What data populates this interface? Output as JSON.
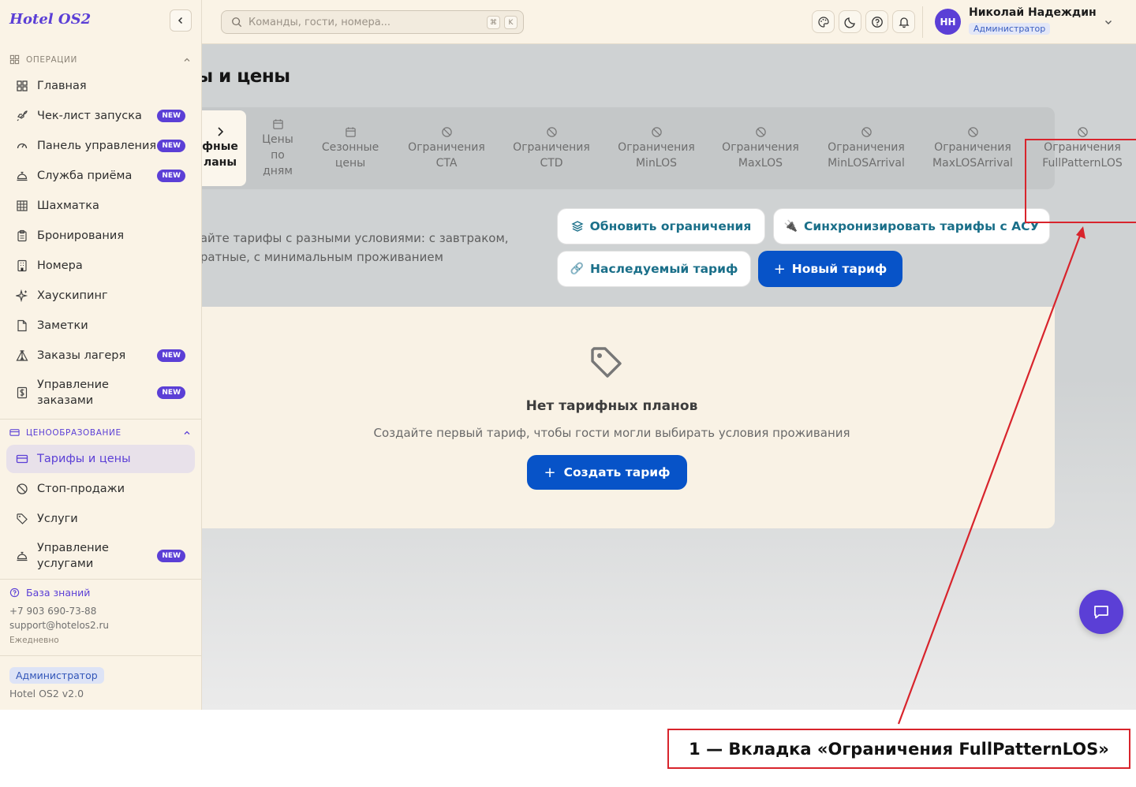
{
  "app": {
    "logo": "Hotel OS2"
  },
  "search": {
    "placeholder": "Команды, гости, номера...",
    "key1": "⌘",
    "key2": "K"
  },
  "user": {
    "initials": "НН",
    "name": "Николай Надеждин",
    "role": "Администратор"
  },
  "sidebar": {
    "section_ops": "ОПЕРАЦИИ",
    "ops_items": [
      {
        "label": "Главная",
        "icon": "dashboard-icon"
      },
      {
        "label": "Чек-лист запуска",
        "icon": "rocket-icon",
        "badge": "NEW"
      },
      {
        "label": "Панель управления",
        "icon": "gauge-icon",
        "badge": "NEW"
      },
      {
        "label": "Служба приёма",
        "icon": "bell-service-icon",
        "badge": "NEW"
      },
      {
        "label": "Шахматка",
        "icon": "grid-icon"
      },
      {
        "label": "Бронирования",
        "icon": "clipboard-icon"
      },
      {
        "label": "Номера",
        "icon": "building-icon"
      },
      {
        "label": "Хаускипинг",
        "icon": "sparkles-icon"
      },
      {
        "label": "Заметки",
        "icon": "note-icon"
      },
      {
        "label": "Заказы лагеря",
        "icon": "tent-icon",
        "badge": "NEW"
      },
      {
        "label": "Управление заказами",
        "icon": "dollar-doc-icon",
        "badge": "NEW"
      }
    ],
    "section_pricing": "ЦЕНООБРАЗОВАНИЕ",
    "pricing_items": [
      {
        "label": "Тарифы и цены",
        "icon": "card-icon"
      },
      {
        "label": "Стоп-продажи",
        "icon": "ban-icon"
      },
      {
        "label": "Услуги",
        "icon": "tag-icon"
      },
      {
        "label": "Управление услугами",
        "icon": "bell-service-icon",
        "badge": "NEW"
      }
    ],
    "knowledge_base": "База знаний",
    "phone": "+7 903 690-73-88",
    "email": "support@hotelos2.ru",
    "schedule": "Ежедневно",
    "role": "Администратор",
    "version": "Hotel OS2 v2.0"
  },
  "page": {
    "title": "фы и цены",
    "tabs": [
      {
        "label": "фные ланы",
        "active": true
      },
      {
        "label": "Цены по дням"
      },
      {
        "label": "Сезонные цены"
      },
      {
        "label": "Ограничения CTA"
      },
      {
        "label": "Ограничения CTD"
      },
      {
        "label": "Ограничения MinLOS"
      },
      {
        "label": "Ограничения MaxLOS"
      },
      {
        "label": "Ограничения MinLOSArrival"
      },
      {
        "label": "Ограничения MaxLOSArrival"
      },
      {
        "label": "Ограничения FullPatternLOS"
      }
    ],
    "description_line1": "вайте тарифы с разными условиями: с завтраком,",
    "description_line2": "вратные, с минимальным проживанием",
    "buttons": {
      "refresh": "Обновить ограничения",
      "sync": "Синхронизировать тарифы с АСУ",
      "inherited": "Наследуемый тариф",
      "new": "Новый тариф"
    },
    "empty": {
      "title": "Нет тарифных планов",
      "text": "Создайте первый тариф, чтобы гости могли выбирать условия проживания",
      "button": "Создать тариф"
    }
  },
  "annotation": {
    "label": "1 — Вкладка «Ограничения FullPatternLOS»"
  },
  "colors": {
    "accent": "#5b3fd6",
    "primary_button": "#0753c8",
    "annotation": "#d8242c",
    "sidebar_bg": "#faf3e6"
  }
}
